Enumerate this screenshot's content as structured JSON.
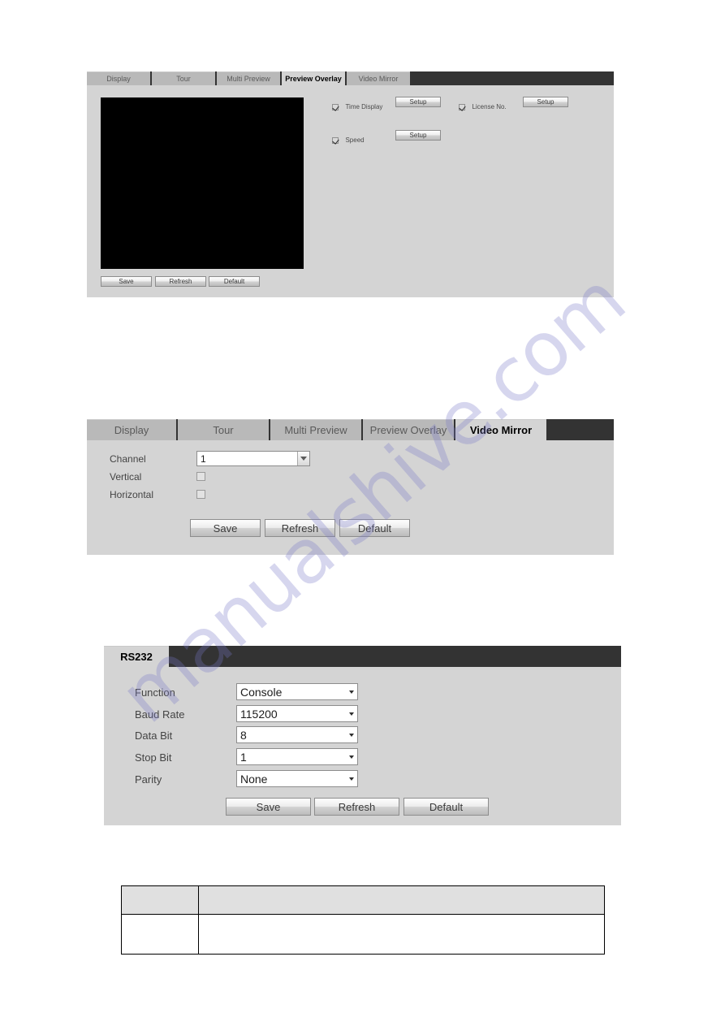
{
  "watermark": {
    "text": "manualshive.com"
  },
  "panel1": {
    "tabs": [
      {
        "label": "Display",
        "active": false
      },
      {
        "label": "Tour",
        "active": false
      },
      {
        "label": "Multi Preview",
        "active": false
      },
      {
        "label": "Preview Overlay",
        "active": true
      },
      {
        "label": "Video Mirror",
        "active": false
      }
    ],
    "overlay_options": [
      {
        "label": "Time Display",
        "checked": true,
        "button": "Setup"
      },
      {
        "label": "License No.",
        "checked": true,
        "button": "Setup"
      },
      {
        "label": "Speed",
        "checked": true,
        "button": "Setup"
      }
    ],
    "actions": [
      "Save",
      "Refresh",
      "Default"
    ]
  },
  "panel2": {
    "tabs": [
      {
        "label": "Display",
        "active": false
      },
      {
        "label": "Tour",
        "active": false
      },
      {
        "label": "Multi Preview",
        "active": false
      },
      {
        "label": "Preview Overlay",
        "active": false
      },
      {
        "label": "Video Mirror",
        "active": true
      }
    ],
    "fields": {
      "channel": {
        "label": "Channel",
        "value": "1"
      },
      "vertical": {
        "label": "Vertical",
        "checked": false
      },
      "horizontal": {
        "label": "Horizontal",
        "checked": false
      }
    },
    "actions": [
      "Save",
      "Refresh",
      "Default"
    ]
  },
  "panel3": {
    "tabs": [
      {
        "label": "RS232",
        "active": true
      }
    ],
    "fields": [
      {
        "label": "Function",
        "value": "Console"
      },
      {
        "label": "Baud Rate",
        "value": "115200"
      },
      {
        "label": "Data Bit",
        "value": "8"
      },
      {
        "label": "Stop Bit",
        "value": "1"
      },
      {
        "label": "Parity",
        "value": "None"
      }
    ],
    "actions": [
      "Save",
      "Refresh",
      "Default"
    ]
  },
  "bottom_table": {
    "header": [
      "",
      ""
    ],
    "rows": [
      [
        "",
        ""
      ]
    ]
  }
}
